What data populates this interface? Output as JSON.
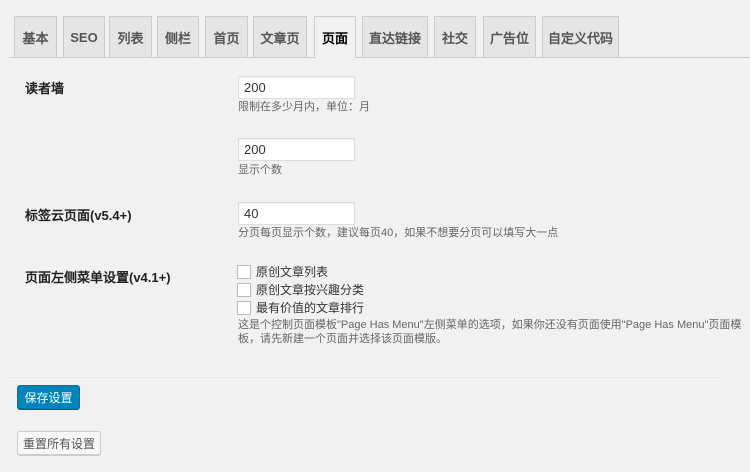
{
  "tabs": [
    "基本",
    "SEO",
    "列表",
    "侧栏",
    "首页",
    "文章页",
    "页面",
    "直达链接",
    "社交",
    "广告位",
    "自定义代码"
  ],
  "active_tab": "页面",
  "reader_wall": {
    "label": "读者墙",
    "months_value": "200",
    "months_desc": "限制在多少月内，单位：月",
    "count_value": "200",
    "count_desc": "显示个数"
  },
  "tag_cloud": {
    "label": "标签云页面(v5.4+)",
    "value": "40",
    "desc": "分页每页显示个数，建议每页40，如果不想要分页可以填写大一点"
  },
  "left_menu": {
    "label": "页面左侧菜单设置(v4.1+)",
    "options": [
      {
        "label": "原创文章列表",
        "checked": false
      },
      {
        "label": "原创文章按兴趣分类",
        "checked": false
      },
      {
        "label": "最有价值的文章排行",
        "checked": false
      }
    ],
    "desc_line1": "这是个控制页面模板\"Page Has Menu\"左侧菜单的选项，如果你还没有页面使用\"Page Has Menu\"页面模",
    "desc_line2": "板，请先新建一个页面并选择该页面模版。"
  },
  "buttons": {
    "save": "保存设置",
    "reset": "重置所有设置"
  }
}
